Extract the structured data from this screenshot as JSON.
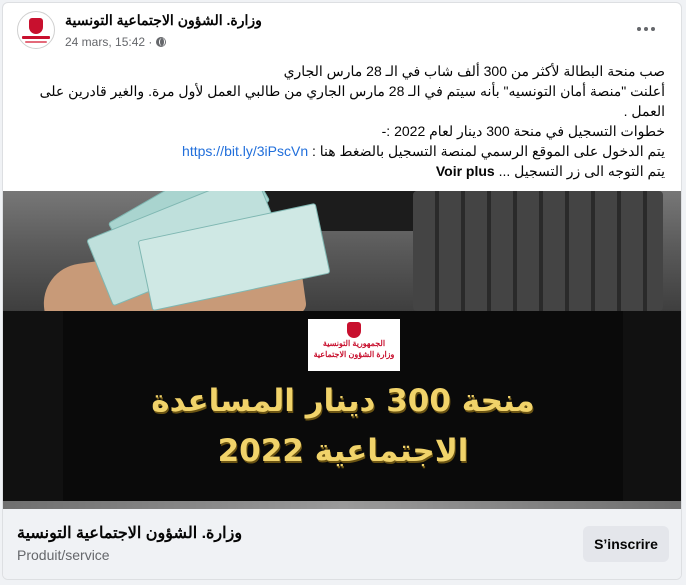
{
  "header": {
    "page_name": "وزارة. الشؤون الاجتماعية التونسية",
    "timestamp": "24 mars, 15:42 ·",
    "visibility_icon": "globe-icon",
    "more_icon": "more-horizontal-icon"
  },
  "post": {
    "line1": "صب منحة البطالة لأكثر من 300 ألف شاب في الـ 28 مارس الجاري",
    "line2": "أعلنت \"منصة أمان التونسيه\" بأنه سيتم في الـ 28 مارس الجاري من  طالبي العمل لأول مرة. والغير قادرين على العمل .",
    "line3": "خطوات التسجيل في منحة 300 دينار لعام 2022  :-",
    "line4_text": "يتم الدخول على الموقع الرسمي لمنصة التسجيل بالضغط هنا : ",
    "line4_link": "https://bit.ly/3iPscVn",
    "line5_text": "يتم التوجه الى زر التسجيل ... ",
    "see_more": "Voir plus"
  },
  "media": {
    "emblem_line1": "الجمهورية التونسية",
    "emblem_line2": "وزارة الشؤون الاجتماعية",
    "headline1": "منحة 300 دينار المساعدة",
    "headline2": "الاجتماعية  2022",
    "headline_color": "#f1d36a"
  },
  "footer": {
    "title": "وزارة. الشؤون الاجتماعية التونسية",
    "subtitle": "Produit/service",
    "subscribe_label": "S’inscrire"
  },
  "colors": {
    "link": "#216fdb",
    "text": "#050505",
    "secondary": "#65676b",
    "background": "#f0f2f5"
  }
}
